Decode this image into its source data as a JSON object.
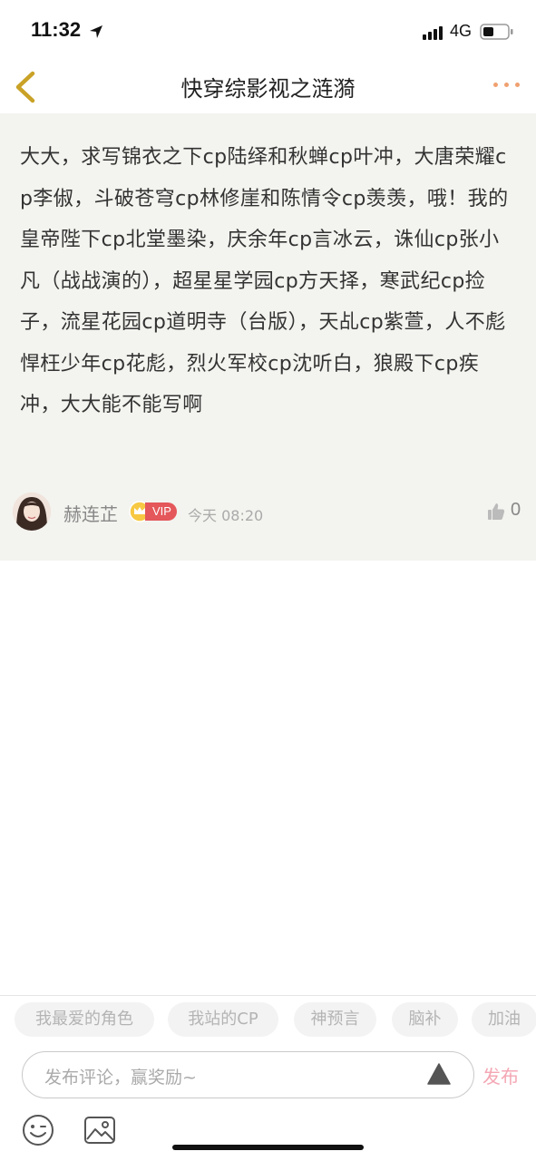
{
  "status_bar": {
    "time": "11:32",
    "network": "4G",
    "icons": [
      "location-arrow-icon",
      "signal-icon",
      "battery-icon"
    ]
  },
  "header": {
    "title": "快穿综影视之涟漪",
    "icons": [
      "back-chevron-icon",
      "more-dots-icon"
    ],
    "accent_color": "#c9a227"
  },
  "post": {
    "content": "大大，求写锦衣之下cp陆绎和秋蝉cp叶冲，大唐荣耀cp李俶，斗破苍穹cp林修崖和陈情令cp羡羡，哦！我的皇帝陛下cp北堂墨染，庆余年cp言冰云，诛仙cp张小凡（战战演的），超星星学园cp方天择，寒武纪cp捡子，流星花园cp道明寺（台版），天乩cp紫萱，人不彪悍枉少年cp花彪，烈火军校cp沈听白，狼殿下cp疾冲，大大能不能写啊",
    "author": "赫连芷",
    "vip_label": "VIP",
    "time": "今天 08:20",
    "likes": "0",
    "background": "#f3f3ef"
  },
  "quick_replies": [
    "我最爱的角色",
    "我站的CP",
    "神预言",
    "脑补",
    "加油"
  ],
  "comment": {
    "placeholder": "发布评论，赢奖励~",
    "publish_label": "发布",
    "publish_color": "#f4a7b4"
  },
  "toolbar_icons": [
    "emoji-icon",
    "image-icon"
  ]
}
